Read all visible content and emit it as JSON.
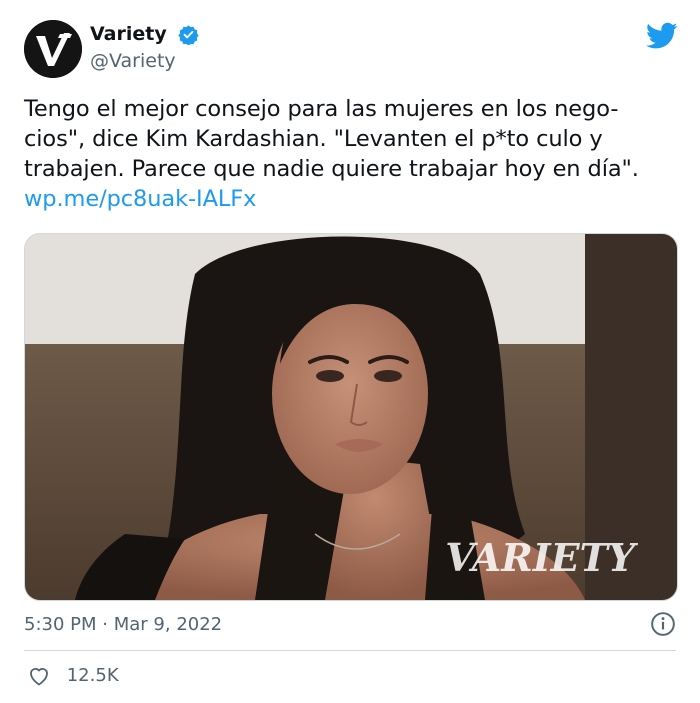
{
  "account": {
    "display_name": "Variety",
    "handle": "@Variety",
    "avatar_icon": "variety-v-logo",
    "verified_icon": "verified-badge-icon"
  },
  "platform_icon": "twitter-bird-icon",
  "tweet": {
    "lines": [
      "Tengo el mejor consejo para las mujeres en los nego-",
      "cios\", dice Kim Kardashian. \"Levanten el p*to culo y",
      "trabajen. Parece que nadie quiere trabajar hoy en día\"."
    ],
    "link": "wp.me/pc8uak-IALFx"
  },
  "media": {
    "watermark": "VARIETY"
  },
  "meta": {
    "time": "5:30 PM",
    "separator": "·",
    "date": "Mar 9, 2022",
    "info_icon": "info-icon"
  },
  "engagement": {
    "like_icon": "heart-icon",
    "likes": "12.5K"
  },
  "colors": {
    "link": "#1d9bf0",
    "secondary_text": "#536471",
    "verified": "#1d9bf0",
    "divider": "#cfd9de"
  }
}
